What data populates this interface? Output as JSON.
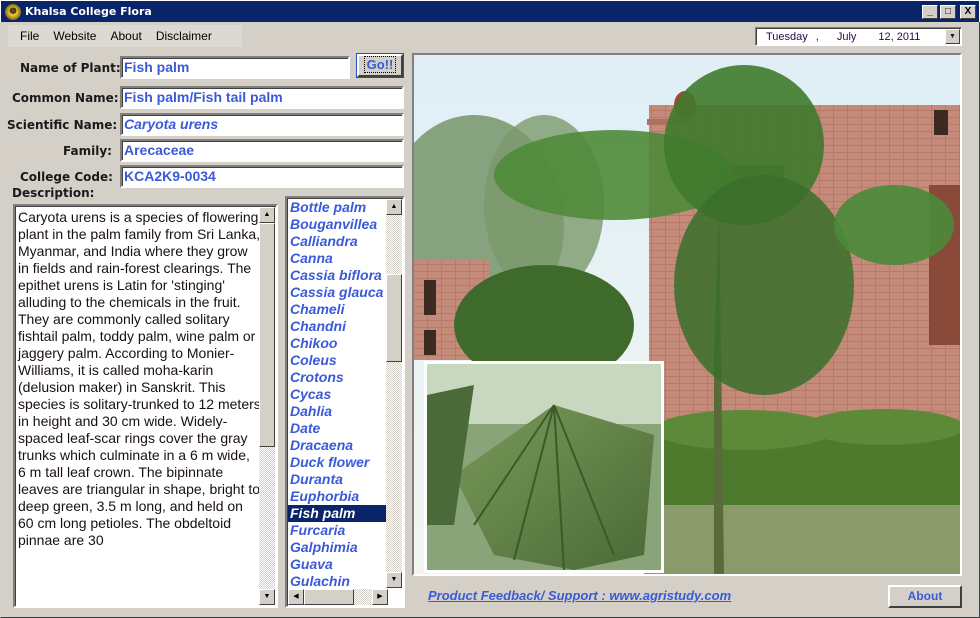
{
  "window": {
    "title": "Khalsa College Flora",
    "controls": {
      "minimize": "_",
      "maximize": "□",
      "close": "X"
    }
  },
  "menu": [
    "File",
    "Website",
    "About",
    "Disclaimer"
  ],
  "date_picker": {
    "day": "Tuesday",
    "separator": ",",
    "month": "July",
    "date": "12, 2011"
  },
  "form": {
    "name_of_plant": {
      "label": "Name of Plant:",
      "value": "Fish palm"
    },
    "go_button": "Go!!",
    "common_name": {
      "label": "Common Name:",
      "value": "Fish palm/Fish tail palm"
    },
    "scientific_name": {
      "label": "Scientific Name:",
      "value": "Caryota urens"
    },
    "family": {
      "label": "Family:",
      "value": "Arecaceae"
    },
    "college_code": {
      "label": "College Code:",
      "value": "KCA2K9-0034"
    },
    "description_label": "Description:",
    "description": "Caryota urens is a species of flowering plant in the palm family from Sri Lanka, Myanmar, and India where they grow in fields and rain-forest clearings. The epithet urens is Latin for 'stinging' alluding to the chemicals in the fruit. They are commonly called solitary fishtail palm, toddy palm, wine palm or jaggery palm. According to Monier-Williams, it is called moha-karin (delusion maker) in Sanskrit. This species is solitary-trunked to 12 meters in height and 30 cm wide. Widely-spaced leaf-scar rings cover the gray trunks which culminate in a 6 m wide, 6 m tall leaf crown. The bipinnate leaves are triangular in shape, bright to deep green, 3.5 m long, and held on 60 cm long petioles. The obdeltoid pinnae are 30"
  },
  "plant_list": {
    "items": [
      "Bottle palm",
      "Bouganvillea",
      "Calliandra",
      "Canna",
      "Cassia biflora",
      "Cassia glauca",
      "Chameli",
      "Chandni",
      "Chikoo",
      "Coleus",
      "Crotons",
      "Cycas",
      "Dahlia",
      "Date",
      "Dracaena",
      "Duck flower",
      "Duranta",
      "Euphorbia",
      "Fish palm",
      "Furcaria",
      "Galphimia",
      "Guava",
      "Gulachin"
    ],
    "selected": "Fish palm"
  },
  "footer": {
    "feedback_link": "Product Feedback/ Support : www.agristudy.com",
    "about_button": "About"
  },
  "colors": {
    "titlebar": "#0a246a",
    "accent_text": "#3a5ad8",
    "face": "#d4d0c8"
  }
}
